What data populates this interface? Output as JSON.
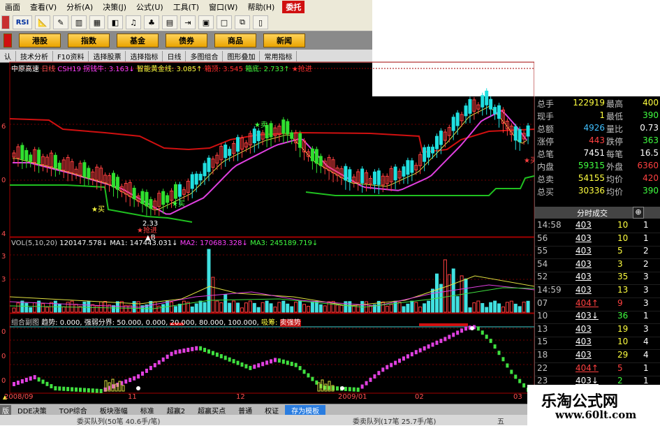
{
  "menubar": {
    "items": [
      "画面",
      "查看(V)",
      "分析(A)",
      "决策(J)",
      "公式(U)",
      "工具(T)",
      "窗口(W)",
      "帮助(H)"
    ],
    "entrust": "委托"
  },
  "toolbar": {
    "rsi": "RSI"
  },
  "navbar": {
    "items": [
      "港股",
      "指数",
      "基金",
      "债券",
      "商品",
      "新闻"
    ]
  },
  "tabs": {
    "items": [
      "认",
      "技术分析",
      "F10资料",
      "选择股票",
      "选择指标",
      "日线",
      "多图组合",
      "图形叠加",
      "常用指标"
    ]
  },
  "main_info": {
    "name": "中原高速",
    "period": "日线",
    "formula": "CSH19",
    "t1": "拐钱牛:",
    "v1": "3.163↓",
    "t2": "智能黄金线:",
    "v2": "3.085↑",
    "t3": "箱顶:",
    "v3": "3.545",
    "t4": "箱底:",
    "v4": "2.733↑",
    "t5": "★抢进"
  },
  "vol_info": {
    "label": "VOL(5,10,20)",
    "v": "120147.578↓",
    "ma1": "MA1: 147443.031↓",
    "ma2": "MA2: 170683.328↓",
    "ma3": "MA3: 245189.719↓"
  },
  "ind_info": {
    "name": "组合副图",
    "text": "趋势: 0.000, 强弱分界: 50.000, 0.000, 20.000, 80.000, 100.000,",
    "t2": "吸筹:",
    "t3": "卖强势"
  },
  "chart_marks": {
    "sell": "★卖",
    "buy1": "★买",
    "buy2": "★买",
    "low": "2.33",
    "grab": "★抢进",
    "a": "▲B",
    "buy3": "★买"
  },
  "axis": {
    "p1": "6",
    "p2": "0",
    "p3": "4",
    "v1": "3",
    "v2": "3",
    "i1": "0",
    "i2": "0",
    "i3": "0"
  },
  "dates": {
    "d1": "2008/09",
    "d2": "11",
    "d3": "12",
    "d4": "2009/01",
    "d5": "02",
    "d6": "03"
  },
  "quote": {
    "rows": [
      [
        "总手",
        "122919",
        "最高",
        "400"
      ],
      [
        "现手",
        "1",
        "最低",
        "390"
      ],
      [
        "总额",
        "4926",
        "量比",
        "0.73"
      ],
      [
        "涨停",
        "443",
        "跌停",
        "363"
      ],
      [
        "总笔",
        "7451",
        "每笔",
        "16.5"
      ],
      [
        "内盘",
        "59315",
        "外盘",
        "6360"
      ],
      [
        "总卖",
        "54155",
        "均价",
        "420"
      ],
      [
        "总买",
        "30336",
        "均价",
        "390"
      ]
    ],
    "tab": "分时成交",
    "tab_right": "⊕",
    "ticks": [
      [
        "14:58",
        "403",
        "10",
        "1"
      ],
      [
        "56",
        "403",
        "10",
        "1"
      ],
      [
        "55",
        "403",
        "5",
        "2"
      ],
      [
        "54",
        "403",
        "3",
        "2"
      ],
      [
        "52",
        "403",
        "35",
        "3"
      ],
      [
        "14:59",
        "403",
        "13",
        "3"
      ],
      [
        "07",
        "404↑",
        "9",
        "3"
      ],
      [
        "10",
        "403↓",
        "36",
        "1"
      ],
      [
        "13",
        "403",
        "19",
        "3"
      ],
      [
        "15",
        "403",
        "10",
        "4"
      ],
      [
        "18",
        "403",
        "29",
        "4"
      ],
      [
        "22",
        "404↑",
        "5",
        "1"
      ],
      [
        "23",
        "403↓",
        "2",
        "1"
      ]
    ]
  },
  "bottomtabs": {
    "items": [
      "版",
      "DDE决策",
      "TOP综合",
      "板块涨幅",
      "标准",
      "超赢2",
      "超赢买点",
      "普通",
      "权证",
      "存为模板"
    ]
  },
  "status": {
    "left": "委买队列(50笔 40.6手/笔)",
    "mid": "委卖队列(17笔 25.7手/笔)",
    "right": "五"
  },
  "watermark": {
    "cn": "乐淘公式网",
    "url": "www.60lt.com"
  }
}
